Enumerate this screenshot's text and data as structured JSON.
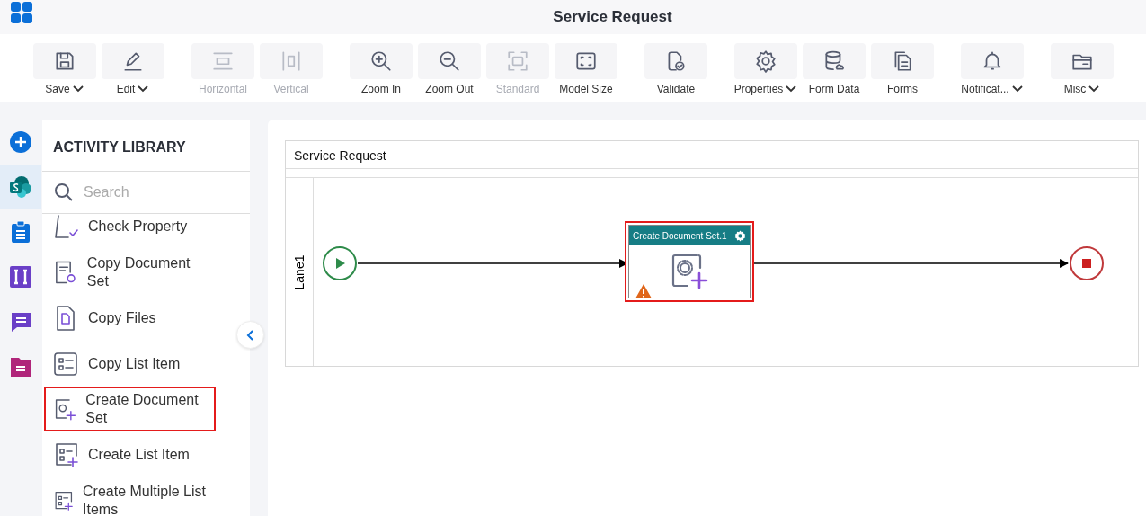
{
  "window": {
    "title": "Service Request"
  },
  "toolbar": {
    "groups": [
      [
        {
          "label": "Save",
          "kind": "save",
          "disabled": false,
          "dropdown": true
        },
        {
          "label": "Edit",
          "kind": "edit",
          "disabled": false,
          "dropdown": true
        }
      ],
      [
        {
          "label": "Horizontal",
          "kind": "horizontal",
          "disabled": true,
          "dropdown": false
        },
        {
          "label": "Vertical",
          "kind": "vertical",
          "disabled": true,
          "dropdown": false
        }
      ],
      [
        {
          "label": "Zoom In",
          "kind": "zoomin",
          "disabled": false,
          "dropdown": false
        },
        {
          "label": "Zoom Out",
          "kind": "zoomout",
          "disabled": false,
          "dropdown": false
        },
        {
          "label": "Standard",
          "kind": "standard",
          "disabled": true,
          "dropdown": false
        },
        {
          "label": "Model Size",
          "kind": "modelsize",
          "disabled": false,
          "dropdown": false
        }
      ],
      [
        {
          "label": "Validate",
          "kind": "validate",
          "disabled": false,
          "dropdown": false
        }
      ],
      [
        {
          "label": "Properties",
          "kind": "gear",
          "disabled": false,
          "dropdown": true
        },
        {
          "label": "Form Data",
          "kind": "database",
          "disabled": false,
          "dropdown": false
        },
        {
          "label": "Forms",
          "kind": "forms",
          "disabled": false,
          "dropdown": false
        }
      ],
      [
        {
          "label": "Notificat...",
          "kind": "bell",
          "disabled": false,
          "dropdown": true
        }
      ],
      [
        {
          "label": "Misc",
          "kind": "folder",
          "disabled": false,
          "dropdown": true
        }
      ]
    ]
  },
  "rail": [
    {
      "kind": "plus",
      "selected": false
    },
    {
      "kind": "sharepoint",
      "selected": true
    },
    {
      "kind": "clipboard",
      "selected": false
    },
    {
      "kind": "text",
      "selected": false
    },
    {
      "kind": "chat",
      "selected": false
    },
    {
      "kind": "folder",
      "selected": false
    }
  ],
  "library": {
    "title": "ACTIVITY LIBRARY",
    "search": {
      "placeholder": "Search"
    },
    "items": [
      {
        "label": "Check Property",
        "kind": "check",
        "selected": false
      },
      {
        "label": "Copy Document Set",
        "kind": "docgear",
        "selected": false
      },
      {
        "label": "Copy Files",
        "kind": "file",
        "selected": false
      },
      {
        "label": "Copy List Item",
        "kind": "list",
        "selected": false
      },
      {
        "label": "Create Document Set",
        "kind": "gearplus",
        "selected": true
      },
      {
        "label": "Create List Item",
        "kind": "listplus",
        "selected": false
      },
      {
        "label": "Create Multiple List Items",
        "kind": "listplus",
        "selected": false
      }
    ]
  },
  "diagram": {
    "pool": "Service Request",
    "lane": "Lane1",
    "node": {
      "title": "Create Document Set.1",
      "selected": true,
      "warning": true
    }
  }
}
